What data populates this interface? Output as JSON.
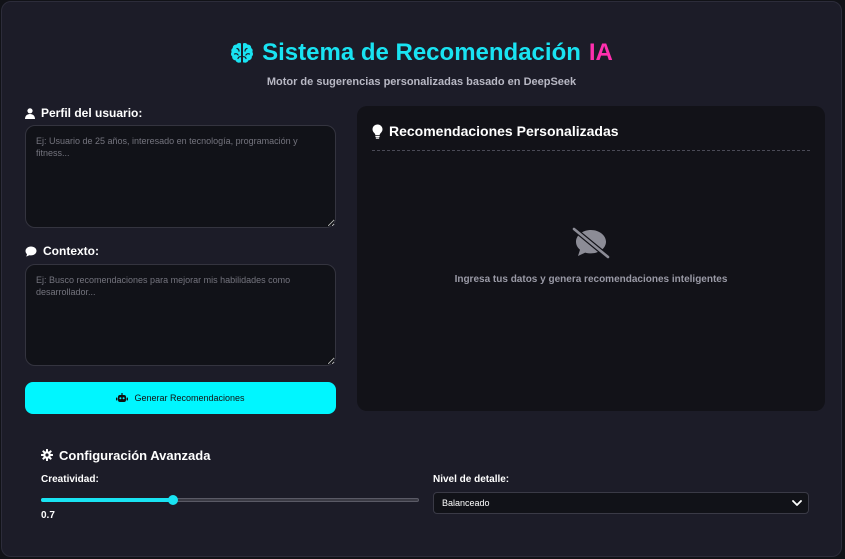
{
  "header": {
    "title_main": "Sistema de Recomendación",
    "title_accent": "IA",
    "subtitle": "Motor de sugerencias personalizadas basado en DeepSeek"
  },
  "form": {
    "profile_label": "Perfil del usuario:",
    "profile_placeholder": "Ej: Usuario de 25 años, interesado en tecnología, programación y fitness...",
    "profile_value": "",
    "context_label": "Contexto:",
    "context_placeholder": "Ej: Busco recomendaciones para mejorar mis habilidades como desarrollador...",
    "context_value": "",
    "generate_button": "Generar Recomendaciones"
  },
  "results": {
    "title": "Recomendaciones Personalizadas",
    "empty_message": "Ingresa tus datos y genera recomendaciones inteligentes"
  },
  "config": {
    "title": "Configuración Avanzada",
    "creativity_label": "Creatividad:",
    "creativity_value": "0.7",
    "creativity_fraction": 0.35,
    "detail_label": "Nivel de detalle:",
    "detail_selected": "Balanceado"
  },
  "colors": {
    "accent_cyan": "#19e3f2",
    "accent_pink": "#ff2fae",
    "button": "#00f6ff",
    "background": "#1c1c28",
    "panel": "#121218"
  },
  "icons": {
    "title": "brain-icon",
    "profile": "user-icon",
    "context": "comment-icon",
    "button": "robot-icon",
    "results": "lightbulb-icon",
    "empty": "comment-slash-icon",
    "config": "gear-icon",
    "select": "chevron-down-icon"
  }
}
